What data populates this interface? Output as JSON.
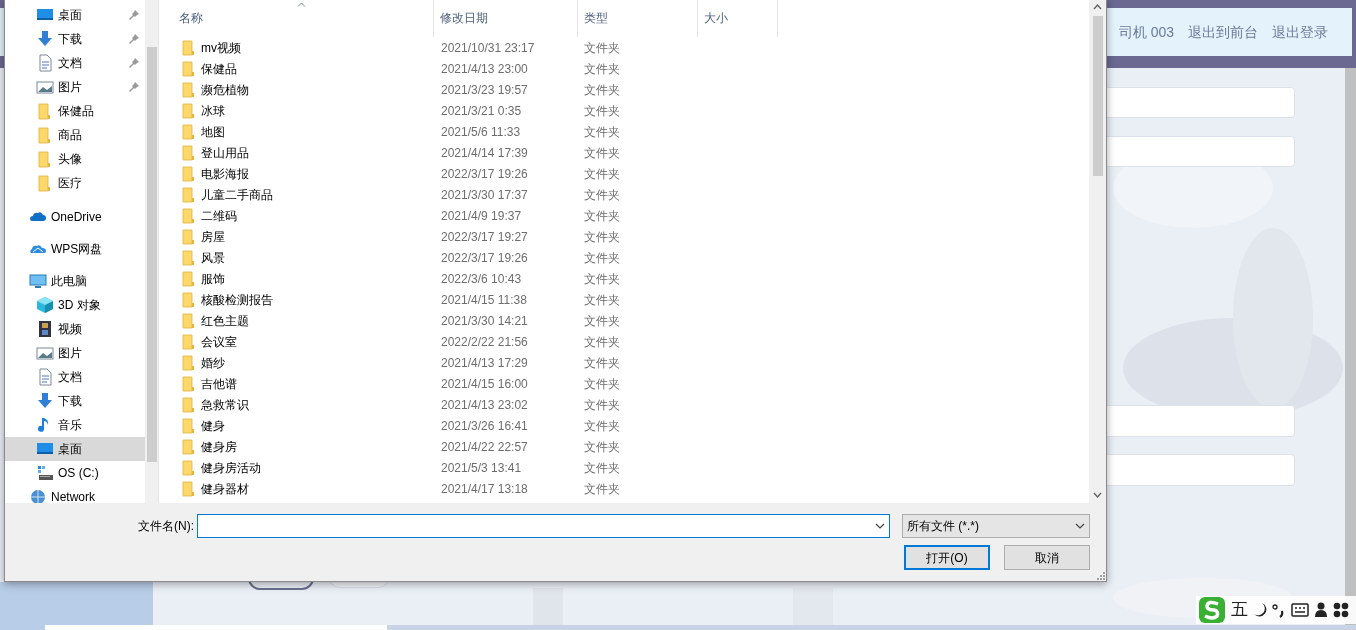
{
  "page": {
    "header_links": [
      "司机 003",
      "退出到前台",
      "退出登录"
    ]
  },
  "dialog": {
    "nav": [
      {
        "label": "桌面",
        "kind": "desktop",
        "pinned": true,
        "selected": false
      },
      {
        "label": "下载",
        "kind": "download",
        "pinned": true,
        "selected": false
      },
      {
        "label": "文档",
        "kind": "document",
        "pinned": true,
        "selected": false
      },
      {
        "label": "图片",
        "kind": "picture",
        "pinned": true,
        "selected": false
      },
      {
        "label": "保健品",
        "kind": "folder",
        "pinned": false,
        "selected": false
      },
      {
        "label": "商品",
        "kind": "folder",
        "pinned": false,
        "selected": false
      },
      {
        "label": "头像",
        "kind": "folder",
        "pinned": false,
        "selected": false
      },
      {
        "label": "医疗",
        "kind": "folder",
        "pinned": false,
        "selected": false
      },
      {
        "label": "OneDrive",
        "kind": "onedrive",
        "pinned": false,
        "selected": false
      },
      {
        "label": "WPS网盘",
        "kind": "wps",
        "pinned": false,
        "selected": false
      },
      {
        "label": "此电脑",
        "kind": "pc",
        "pinned": false,
        "selected": false
      },
      {
        "label": "3D 对象",
        "kind": "cube",
        "pinned": false,
        "selected": false
      },
      {
        "label": "视频",
        "kind": "video",
        "pinned": false,
        "selected": false
      },
      {
        "label": "图片",
        "kind": "picture",
        "pinned": false,
        "selected": false
      },
      {
        "label": "文档",
        "kind": "document",
        "pinned": false,
        "selected": false
      },
      {
        "label": "下载",
        "kind": "download",
        "pinned": false,
        "selected": false
      },
      {
        "label": "音乐",
        "kind": "music",
        "pinned": false,
        "selected": false
      },
      {
        "label": "桌面",
        "kind": "desktop",
        "pinned": false,
        "selected": true
      },
      {
        "label": "OS (C:)",
        "kind": "drive",
        "pinned": false,
        "selected": false
      },
      {
        "label": "Network",
        "kind": "network",
        "pinned": false,
        "selected": false
      }
    ],
    "columns": [
      "名称",
      "修改日期",
      "类型",
      "大小"
    ],
    "files": [
      {
        "name": "mv视频",
        "modified": "2021/10/31 23:17",
        "type": "文件夹"
      },
      {
        "name": "保健品",
        "modified": "2021/4/13 23:00",
        "type": "文件夹"
      },
      {
        "name": "濒危植物",
        "modified": "2021/3/23 19:57",
        "type": "文件夹"
      },
      {
        "name": "冰球",
        "modified": "2021/3/21 0:35",
        "type": "文件夹"
      },
      {
        "name": "地图",
        "modified": "2021/5/6 11:33",
        "type": "文件夹"
      },
      {
        "name": "登山用品",
        "modified": "2021/4/14 17:39",
        "type": "文件夹"
      },
      {
        "name": "电影海报",
        "modified": "2022/3/17 19:26",
        "type": "文件夹"
      },
      {
        "name": "儿童二手商品",
        "modified": "2021/3/30 17:37",
        "type": "文件夹"
      },
      {
        "name": "二维码",
        "modified": "2021/4/9 19:37",
        "type": "文件夹"
      },
      {
        "name": "房屋",
        "modified": "2022/3/17 19:27",
        "type": "文件夹"
      },
      {
        "name": "风景",
        "modified": "2022/3/17 19:26",
        "type": "文件夹"
      },
      {
        "name": "服饰",
        "modified": "2022/3/6 10:43",
        "type": "文件夹"
      },
      {
        "name": "核酸检测报告",
        "modified": "2021/4/15 11:38",
        "type": "文件夹"
      },
      {
        "name": "红色主题",
        "modified": "2021/3/30 14:21",
        "type": "文件夹"
      },
      {
        "name": "会议室",
        "modified": "2022/2/22 21:56",
        "type": "文件夹"
      },
      {
        "name": "婚纱",
        "modified": "2021/4/13 17:29",
        "type": "文件夹"
      },
      {
        "name": "吉他谱",
        "modified": "2021/4/15 16:00",
        "type": "文件夹"
      },
      {
        "name": "急救常识",
        "modified": "2021/4/13 23:02",
        "type": "文件夹"
      },
      {
        "name": "健身",
        "modified": "2021/3/26 16:41",
        "type": "文件夹"
      },
      {
        "name": "健身房",
        "modified": "2021/4/22 22:57",
        "type": "文件夹"
      },
      {
        "name": "健身房活动",
        "modified": "2021/5/3 13:41",
        "type": "文件夹"
      },
      {
        "name": "健身器材",
        "modified": "2021/4/17 13:18",
        "type": "文件夹"
      }
    ],
    "filename_label": "文件名(N):",
    "filter": "所有文件 (*.*)",
    "buttons": [
      "打开(O)",
      "取消"
    ]
  },
  "ime_toolbar": {
    "mode": "五"
  }
}
